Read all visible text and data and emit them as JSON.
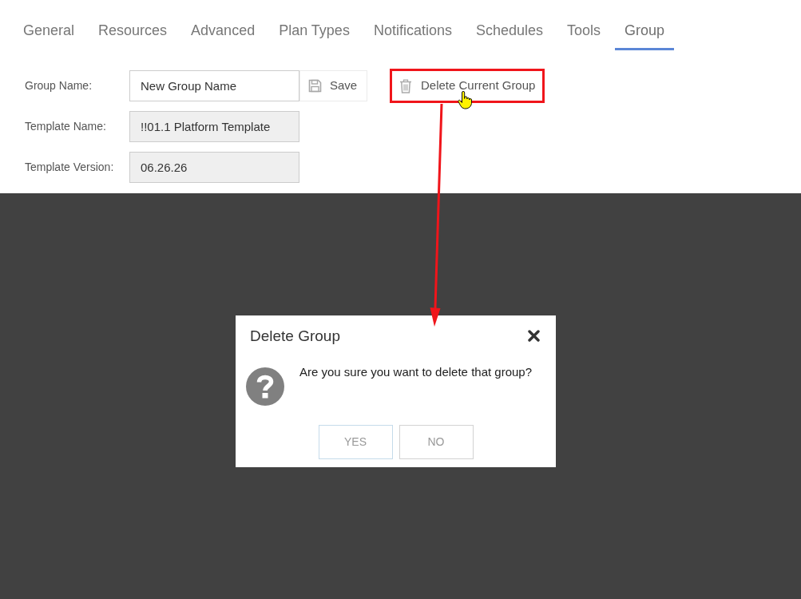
{
  "tabs": [
    {
      "label": "General",
      "selected": false
    },
    {
      "label": "Resources",
      "selected": false
    },
    {
      "label": "Advanced",
      "selected": false
    },
    {
      "label": "Plan Types",
      "selected": false
    },
    {
      "label": "Notifications",
      "selected": false
    },
    {
      "label": "Schedules",
      "selected": false
    },
    {
      "label": "Tools",
      "selected": false
    },
    {
      "label": "Group",
      "selected": true
    }
  ],
  "form": {
    "fields": [
      {
        "label": "Group Name:",
        "value": "New Group Name",
        "readonly": false
      },
      {
        "label": "Template Name:",
        "value": "!!01.1 Platform Template",
        "readonly": true
      },
      {
        "label": "Template Version:",
        "value": "06.26.26",
        "readonly": true
      }
    ],
    "save_button": {
      "label": "Save"
    },
    "delete_button": {
      "label": "Delete Current Group",
      "highlighted": true
    }
  },
  "dialog": {
    "title": "Delete Group",
    "message": "Are you sure you want to delete that group?",
    "buttons": [
      {
        "label": "YES",
        "focused": true
      },
      {
        "label": "NO",
        "focused": false
      }
    ]
  }
}
